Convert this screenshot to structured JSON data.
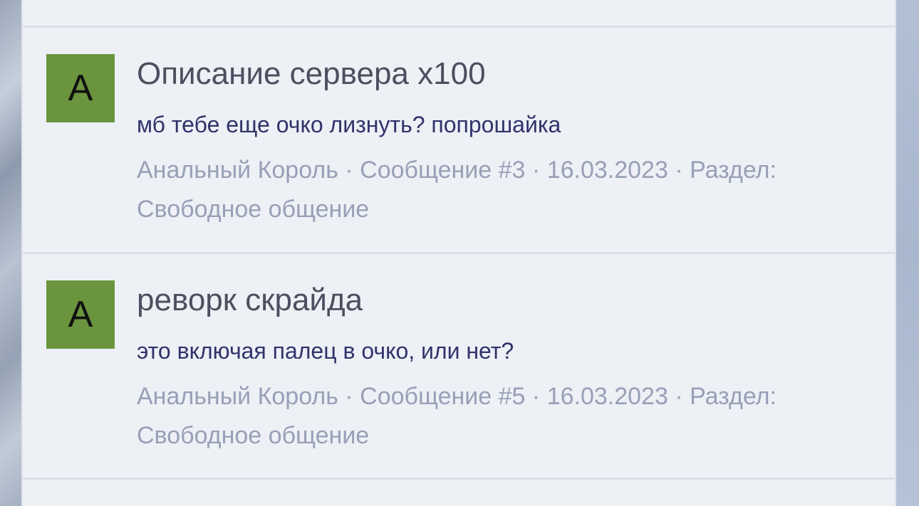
{
  "results": [
    {
      "avatar_letter": "A",
      "title": "Описание сервера x100",
      "snippet": "мб тебе еще очко лизнуть? попрошайка",
      "author": "Анальный Король",
      "separator": "·",
      "message_label": "Сообщение #3",
      "date": "16.03.2023",
      "section_label": "Раздел:",
      "section_name": "Свободное общение"
    },
    {
      "avatar_letter": "A",
      "title": "реворк скрайда",
      "snippet": "это включая палец в очко, или нет?",
      "author": "Анальный Король",
      "separator": "·",
      "message_label": "Сообщение #5",
      "date": "16.03.2023",
      "section_label": "Раздел:",
      "section_name": "Свободное общение"
    }
  ],
  "colors": {
    "avatar_bg": "#6a953e",
    "title": "#4b5060",
    "snippet": "#30336a",
    "meta": "#98a0b7",
    "panel_bg": "#edf0f5"
  }
}
